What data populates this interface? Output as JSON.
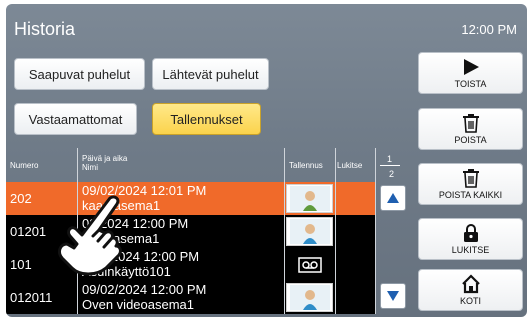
{
  "header": {
    "title": "Historia",
    "time": "12:00 PM"
  },
  "tabs": [
    {
      "label": "Saapuvat puhelut"
    },
    {
      "label": "Lähtevät puhelut"
    },
    {
      "label": "Vastaamattomat"
    },
    {
      "label": "Tallennukset",
      "active": true
    }
  ],
  "table": {
    "col_number": "Numero",
    "col_date": "Päivä ja aika",
    "col_name": "Nimi",
    "col_recording": "Tallennus",
    "col_lock": "Lukitse",
    "rows": [
      {
        "number": "202",
        "date": "09/02/2024 12:01 PM",
        "name": "kaan asema1",
        "recording": "video-thumbnail",
        "selected": true
      },
      {
        "number": "01201",
        "date": "02/2024 12:00 PM",
        "name": "videoasema1",
        "recording": "video-thumbnail"
      },
      {
        "number": "101",
        "date": "9/02/2024 12:00 PM",
        "name": "Asuinkäyttö101",
        "recording": "audio-tape-icon"
      },
      {
        "number": "012011",
        "date": "09/02/2024 12:00 PM",
        "name": "Oven videoasema1",
        "recording": "video-thumbnail"
      }
    ]
  },
  "pager": {
    "current": "1",
    "total": "2"
  },
  "side_buttons": [
    {
      "label": "TOISTA",
      "icon": "play-icon"
    },
    {
      "label": "POISTA",
      "icon": "trash-icon"
    },
    {
      "label": "POISTA KAIKKI",
      "icon": "trash-icon"
    },
    {
      "label": "LUKITSE",
      "icon": "lock-icon"
    },
    {
      "label": "KOTI",
      "icon": "home-icon"
    }
  ],
  "colors": {
    "background": "#6f7b88",
    "selected_row": "#f06a2a",
    "active_tab": "#fbd34c",
    "accent_blue": "#1f5fb0"
  }
}
